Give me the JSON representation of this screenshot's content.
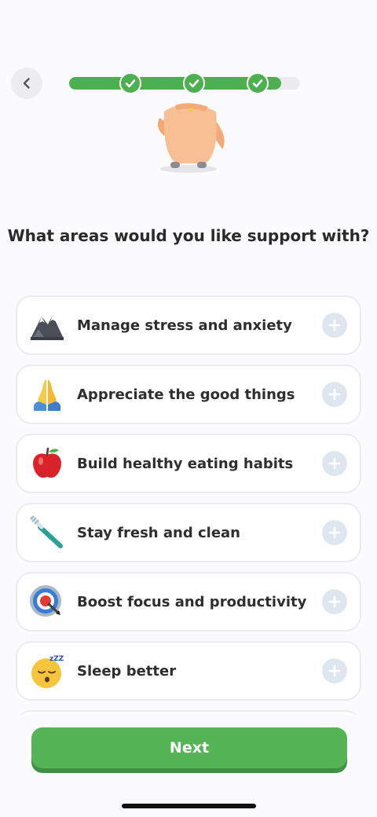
{
  "header": {
    "back_icon": "chevron-left-icon",
    "progress": {
      "completed_steps": 3,
      "total_steps": 4,
      "fill_fraction": 0.92
    }
  },
  "question": "What areas would you like support with?",
  "options": [
    {
      "emoji": "mountain-icon",
      "label": "Manage stress and anxiety"
    },
    {
      "emoji": "praying-hands-icon",
      "label": "Appreciate the good things"
    },
    {
      "emoji": "apple-icon",
      "label": "Build healthy eating habits"
    },
    {
      "emoji": "toothbrush-icon",
      "label": "Stay fresh and clean"
    },
    {
      "emoji": "target-icon",
      "label": "Boost focus and productivity"
    },
    {
      "emoji": "sleeping-face-icon",
      "label": "Sleep better"
    }
  ],
  "footer": {
    "next_label": "Next"
  },
  "colors": {
    "accent": "#55b456",
    "progress": "#4caf50",
    "add_bg": "#dfe6ef"
  }
}
